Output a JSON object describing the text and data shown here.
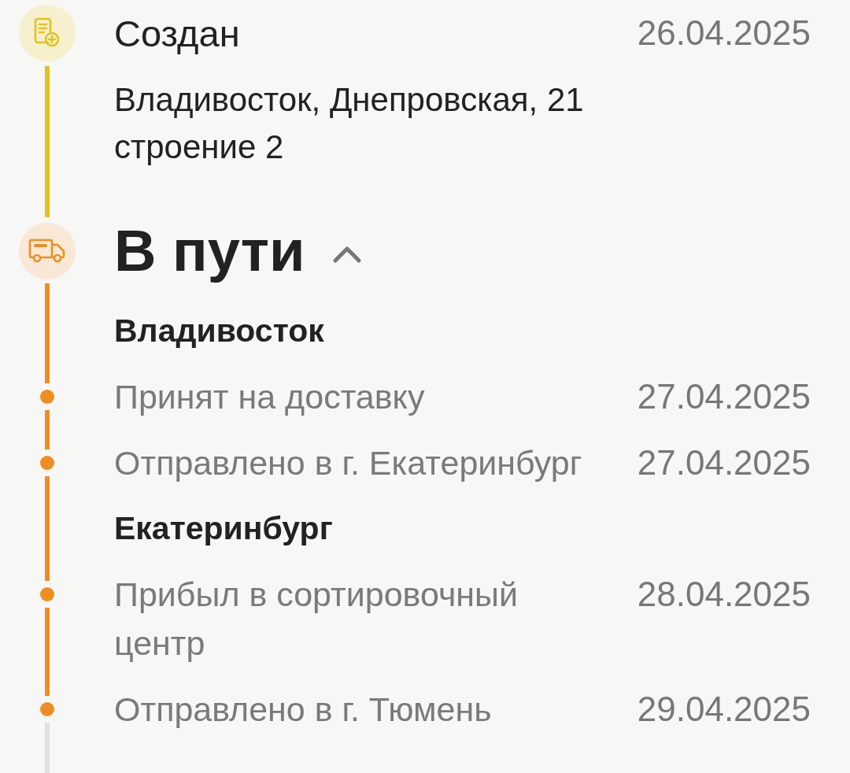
{
  "stages": [
    {
      "kind": "created",
      "title": "Создан",
      "date": "26.04.2025",
      "color": "#e3c21f",
      "address": [
        "Владивосток, Днепровская, 21",
        "строение 2"
      ]
    },
    {
      "kind": "transit",
      "title": "В пути",
      "expanded": true,
      "color": "#ee8e22",
      "groups": [
        {
          "city": "Владивосток",
          "events": [
            {
              "text": "Принят на доставку",
              "date": "27.04.2025"
            },
            {
              "text": "Отправлено в г. Екатеринбург",
              "date": "27.04.2025"
            }
          ]
        },
        {
          "city": "Екатеринбург",
          "events": [
            {
              "text": "Прибыл в сортировочный центр",
              "date": "28.04.2025"
            },
            {
              "text": "Отправлено в г. Тюмень",
              "date": "29.04.2025"
            }
          ]
        }
      ]
    }
  ]
}
